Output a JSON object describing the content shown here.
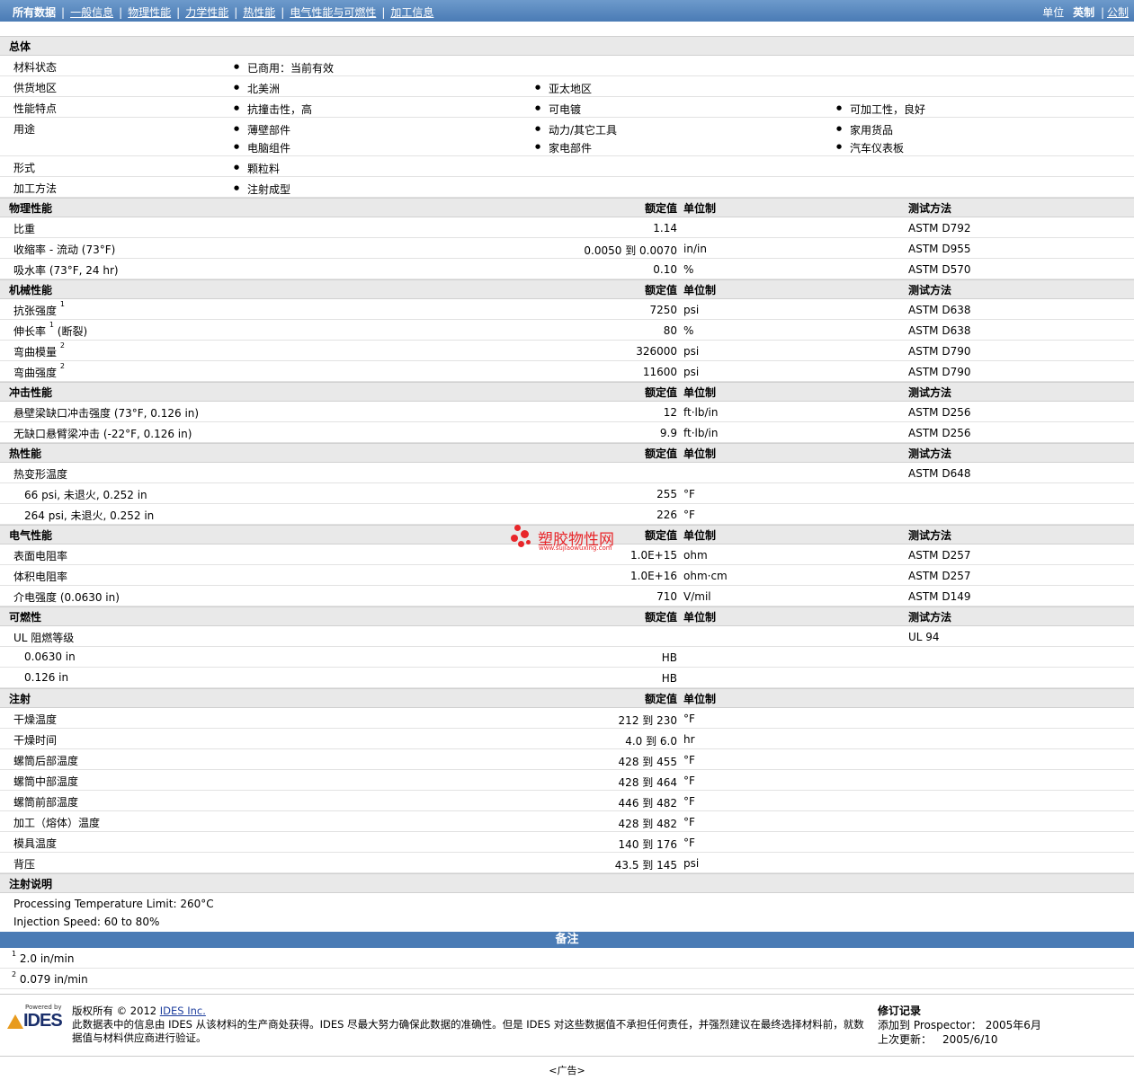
{
  "nav": {
    "tabs": [
      "所有数据",
      "一般信息",
      "物理性能",
      "力学性能",
      "热性能",
      "电气性能与可燃性",
      "加工信息"
    ],
    "units_label": "单位",
    "units_current": "英制",
    "units_alt": "公制"
  },
  "general": {
    "title": "总体",
    "rows": [
      {
        "label": "材料状态",
        "items": [
          "已商用：当前有效"
        ]
      },
      {
        "label": "供货地区",
        "items": [
          "北美洲",
          "亚太地区"
        ]
      },
      {
        "label": "性能特点",
        "items": [
          "抗撞击性，高",
          "可电镀",
          "可加工性，良好"
        ]
      },
      {
        "label": "用途",
        "items": [
          "薄壁部件",
          "动力/其它工具",
          "家用货品",
          "电脑组件",
          "家电部件",
          "汽车仪表板"
        ]
      },
      {
        "label": "形式",
        "items": [
          "颗粒料"
        ]
      },
      {
        "label": "加工方法",
        "items": [
          "注射成型"
        ]
      }
    ]
  },
  "headers": {
    "value": "额定值",
    "unit": "单位制",
    "method": "测试方法"
  },
  "sections": [
    {
      "title": "物理性能",
      "show_method": true,
      "rows": [
        {
          "label": "比重",
          "value": "1.14",
          "unit": "",
          "method": "ASTM D792"
        },
        {
          "label": "收缩率 - 流动 (73°F)",
          "value": "0.0050 到  0.0070",
          "unit": "in/in",
          "method": "ASTM D955"
        },
        {
          "label": "吸水率 (73°F, 24 hr)",
          "value": "0.10",
          "unit": "%",
          "method": "ASTM D570"
        }
      ]
    },
    {
      "title": "机械性能",
      "show_method": true,
      "rows": [
        {
          "label": "抗张强度",
          "sup": "1",
          "value": "7250",
          "unit": "psi",
          "method": "ASTM D638"
        },
        {
          "label": "伸长率",
          "sup": "1",
          "suffix": "(断裂)",
          "value": "80",
          "unit": "%",
          "method": "ASTM D638"
        },
        {
          "label": "弯曲模量",
          "sup": "2",
          "value": "326000",
          "unit": "psi",
          "method": "ASTM D790"
        },
        {
          "label": "弯曲强度",
          "sup": "2",
          "value": "11600",
          "unit": "psi",
          "method": "ASTM D790"
        }
      ]
    },
    {
      "title": "冲击性能",
      "show_method": true,
      "rows": [
        {
          "label": "悬壁梁缺口冲击强度 (73°F, 0.126 in)",
          "value": "12",
          "unit": "ft·lb/in",
          "method": "ASTM D256"
        },
        {
          "label": "无缺口悬臂梁冲击 (-22°F, 0.126 in)",
          "value": "9.9",
          "unit": "ft·lb/in",
          "method": "ASTM D256"
        }
      ]
    },
    {
      "title": "热性能",
      "show_method": true,
      "rows": [
        {
          "label": "热变形温度",
          "value": "",
          "unit": "",
          "method": "ASTM D648"
        },
        {
          "label": "66 psi, 未退火, 0.252 in",
          "sub": true,
          "value": "255",
          "unit": "°F",
          "method": ""
        },
        {
          "label": "264 psi, 未退火, 0.252 in",
          "sub": true,
          "value": "226",
          "unit": "°F",
          "method": ""
        }
      ]
    },
    {
      "title": "电气性能",
      "show_method": true,
      "rows": [
        {
          "label": "表面电阻率",
          "value": "1.0E+15",
          "unit": "ohm",
          "method": "ASTM D257"
        },
        {
          "label": "体积电阻率",
          "value": "1.0E+16",
          "unit": "ohm·cm",
          "method": "ASTM D257"
        },
        {
          "label": "介电强度 (0.0630 in)",
          "value": "710",
          "unit": "V/mil",
          "method": "ASTM D149"
        }
      ]
    },
    {
      "title": "可燃性",
      "show_method": true,
      "rows": [
        {
          "label": "UL 阻燃等级",
          "value": "",
          "unit": "",
          "method": "UL 94"
        },
        {
          "label": "0.0630 in",
          "sub": true,
          "value": "HB",
          "unit": "",
          "method": ""
        },
        {
          "label": "0.126 in",
          "sub": true,
          "value": "HB",
          "unit": "",
          "method": ""
        }
      ]
    },
    {
      "title": "注射",
      "show_method": false,
      "rows": [
        {
          "label": "干燥温度",
          "value": "212 到  230",
          "unit": "°F",
          "method": ""
        },
        {
          "label": "干燥时间",
          "value": "4.0 到  6.0",
          "unit": "hr",
          "method": ""
        },
        {
          "label": "螺筒后部温度",
          "value": "428 到  455",
          "unit": "°F",
          "method": ""
        },
        {
          "label": "螺筒中部温度",
          "value": "428 到  464",
          "unit": "°F",
          "method": ""
        },
        {
          "label": "螺筒前部温度",
          "value": "446 到  482",
          "unit": "°F",
          "method": ""
        },
        {
          "label": "加工（熔体）温度",
          "value": "428 到  482",
          "unit": "°F",
          "method": ""
        },
        {
          "label": "模具温度",
          "value": "140 到  176",
          "unit": "°F",
          "method": ""
        },
        {
          "label": "背压",
          "value": "43.5 到  145",
          "unit": "psi",
          "method": ""
        }
      ]
    }
  ],
  "injection_notes": {
    "title": "注射说明",
    "lines": [
      "Processing Temperature Limit: 260°C",
      "Injection Speed: 60 to 80%"
    ]
  },
  "remarks": {
    "title": "备注",
    "items": [
      {
        "num": "1",
        "text": "2.0 in/min"
      },
      {
        "num": "2",
        "text": "0.079 in/min"
      }
    ]
  },
  "footer": {
    "logo_small": "Powered by",
    "logo_text": "IDES",
    "copyright": "版权所有 © 2012 ",
    "company_link": "IDES Inc.",
    "disclaimer": "此数据表中的信息由 IDES 从该材料的生产商处获得。IDES 尽最大努力确保此数据的准确性。但是 IDES 对这些数据值不承担任何责任，并强烈建议在最终选择材料前，就数据值与材料供应商进行验证。",
    "rev_title": "修订记录",
    "added_label": "添加到 Prospector：",
    "added_value": "2005年6月",
    "updated_label": "上次更新：",
    "updated_value": "2005/6/10",
    "ad": "<广告>"
  },
  "watermark": {
    "title": "塑胶物性网",
    "url": "www.sujiaowuxing.com"
  }
}
